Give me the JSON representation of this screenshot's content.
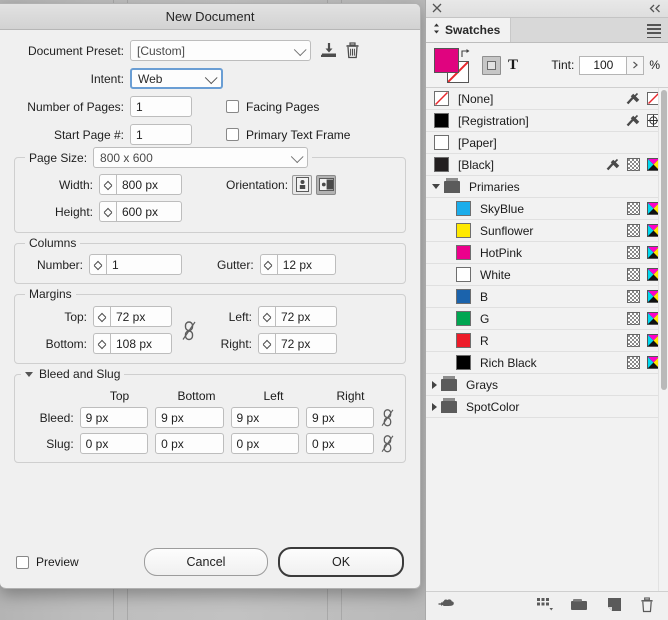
{
  "dialog": {
    "title": "New Document",
    "preset": {
      "label": "Document Preset:",
      "value": "[Custom]"
    },
    "intent": {
      "label": "Intent:",
      "value": "Web"
    },
    "pages": {
      "label": "Number of Pages:",
      "value": "1"
    },
    "start_page": {
      "label": "Start Page #:",
      "value": "1"
    },
    "facing_pages": {
      "label": "Facing Pages",
      "checked": false
    },
    "primary_text_frame": {
      "label": "Primary Text Frame",
      "checked": false
    },
    "page_size": {
      "legend": "Page Size:",
      "value": "800 x 600",
      "width": {
        "label": "Width:",
        "value": "800 px"
      },
      "height": {
        "label": "Height:",
        "value": "600 px"
      },
      "orientation": {
        "label": "Orientation:",
        "portrait": "portrait-orientation",
        "landscape": "landscape-orientation",
        "selected": "landscape"
      }
    },
    "columns": {
      "legend": "Columns",
      "number": {
        "label": "Number:",
        "value": "1"
      },
      "gutter": {
        "label": "Gutter:",
        "value": "12 px"
      }
    },
    "margins": {
      "legend": "Margins",
      "top": {
        "label": "Top:",
        "value": "72 px"
      },
      "bottom": {
        "label": "Bottom:",
        "value": "108 px"
      },
      "left": {
        "label": "Left:",
        "value": "72 px"
      },
      "right": {
        "label": "Right:",
        "value": "72 px"
      },
      "link_icon": "chain-broken-icon"
    },
    "bleed_slug": {
      "legend": "Bleed and Slug",
      "columns": [
        "Top",
        "Bottom",
        "Left",
        "Right"
      ],
      "bleed": {
        "label": "Bleed:",
        "values": [
          "9 px",
          "9 px",
          "9 px",
          "9 px"
        ]
      },
      "slug": {
        "label": "Slug:",
        "values": [
          "0 px",
          "0 px",
          "0 px",
          "0 px"
        ]
      }
    },
    "footer": {
      "preview": {
        "label": "Preview",
        "checked": false
      },
      "cancel": "Cancel",
      "ok": "OK"
    },
    "icons": {
      "save_preset": "save-preset-icon",
      "delete_preset": "trash-icon"
    }
  },
  "swatches_panel": {
    "close_icon": "close-icon",
    "collapse_icon": "collapse-panel-icon",
    "tab_label": "Swatches",
    "menu_icon": "panel-menu-icon",
    "fill_color": "#e0037f",
    "stroke_color": "none",
    "format_icons": {
      "container": "formatting-affects-container-icon",
      "text": "formatting-affects-text-icon"
    },
    "tint": {
      "label": "Tint:",
      "value": "100",
      "unit": "%"
    },
    "footer_icons": [
      "show-swatch-kinds-icon",
      "new-color-group-icon",
      "new-swatch-icon",
      "delete-swatch-icon"
    ],
    "swatches": [
      {
        "name": "[None]",
        "color": "none",
        "type": "none",
        "indent": false,
        "icons": [
          "spot-icon",
          "none-icon"
        ]
      },
      {
        "name": "[Registration]",
        "color": "#000000",
        "type": "registration",
        "indent": false,
        "icons": [
          "spot-icon",
          "registration-icon"
        ]
      },
      {
        "name": "[Paper]",
        "color": "#ffffff",
        "type": "paper",
        "indent": false,
        "icons": []
      },
      {
        "name": "[Black]",
        "color": "#231f20",
        "type": "process",
        "indent": false,
        "icons": [
          "spot-icon",
          "tint-icon",
          "cmyk-icon"
        ]
      },
      {
        "name": "Primaries",
        "type": "group",
        "open": true,
        "indent": false,
        "icons": []
      },
      {
        "name": "SkyBlue",
        "color": "#1badeb",
        "type": "process",
        "indent": true,
        "icons": [
          "tint-icon",
          "cmyk-icon"
        ]
      },
      {
        "name": "Sunflower",
        "color": "#ffe900",
        "type": "process",
        "indent": true,
        "icons": [
          "tint-icon",
          "cmyk-icon"
        ]
      },
      {
        "name": "HotPink",
        "color": "#ec008c",
        "type": "process",
        "indent": true,
        "icons": [
          "tint-icon",
          "cmyk-icon"
        ]
      },
      {
        "name": "White",
        "color": "#ffffff",
        "type": "process",
        "indent": true,
        "icons": [
          "tint-icon",
          "cmyk-icon"
        ]
      },
      {
        "name": "B",
        "color": "#1b63ac",
        "type": "process",
        "indent": true,
        "icons": [
          "tint-icon",
          "cmyk-icon"
        ]
      },
      {
        "name": "G",
        "color": "#00a651",
        "type": "process",
        "indent": true,
        "icons": [
          "tint-icon",
          "cmyk-icon"
        ]
      },
      {
        "name": "R",
        "color": "#ed1c29",
        "type": "process",
        "indent": true,
        "icons": [
          "tint-icon",
          "cmyk-icon"
        ]
      },
      {
        "name": "Rich Black",
        "color": "#000000",
        "type": "process",
        "indent": true,
        "icons": [
          "tint-icon",
          "cmyk-icon"
        ]
      },
      {
        "name": "Grays",
        "type": "group",
        "open": false,
        "indent": false,
        "icons": []
      },
      {
        "name": "SpotColor",
        "type": "group",
        "open": false,
        "indent": false,
        "icons": []
      }
    ]
  }
}
